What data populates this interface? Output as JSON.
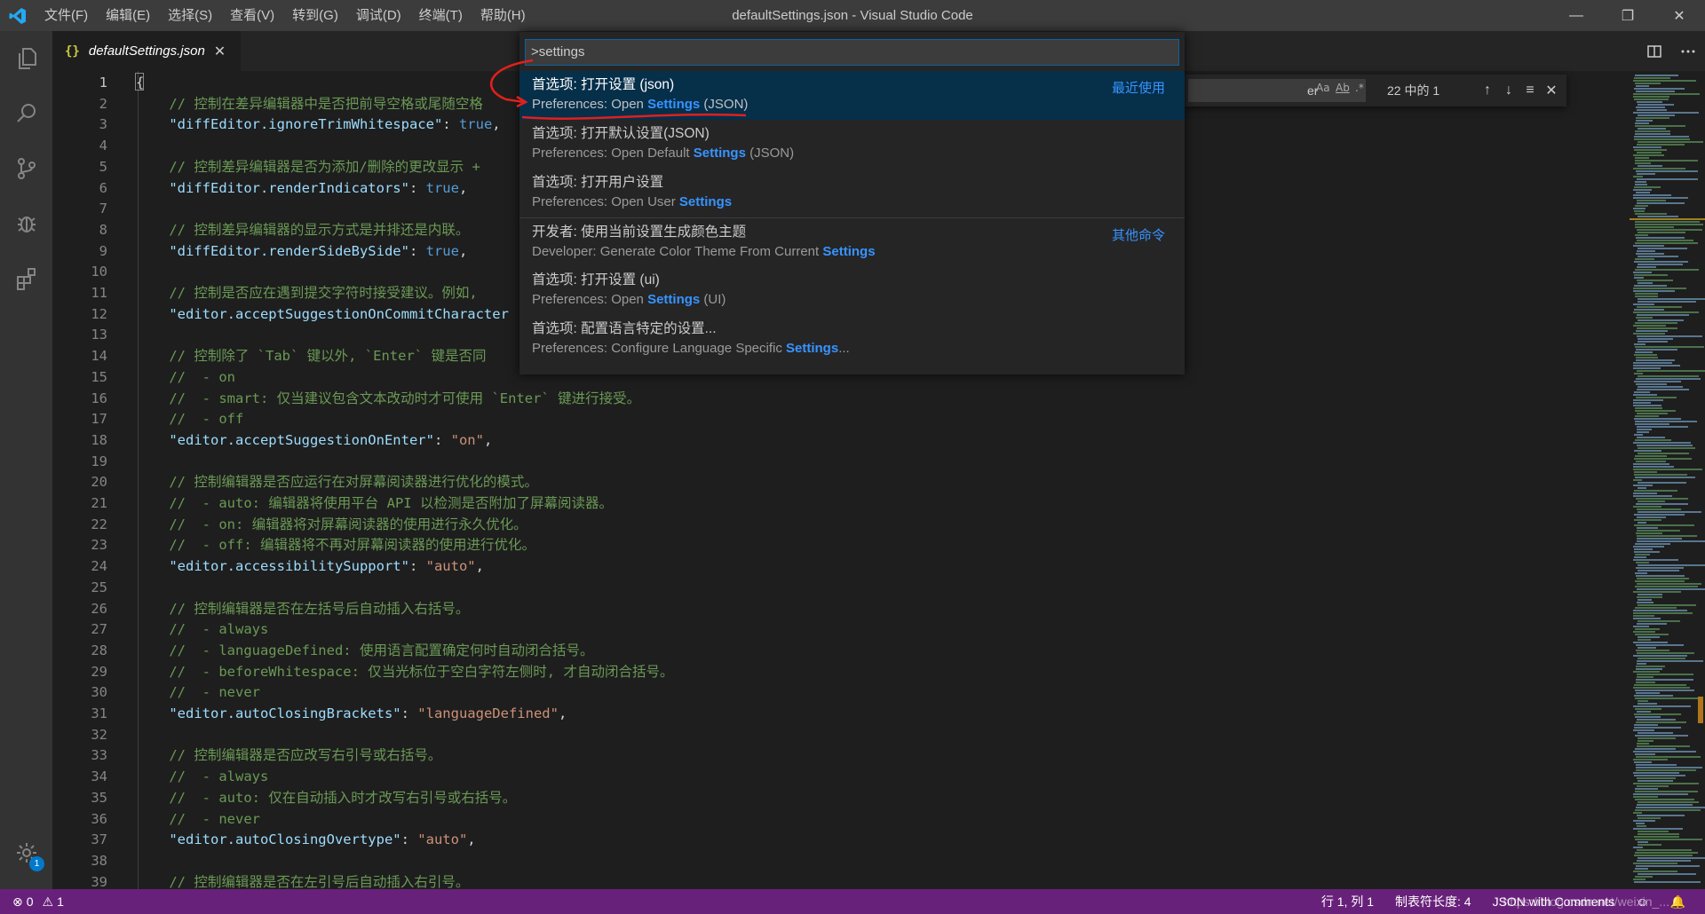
{
  "window": {
    "title": "defaultSettings.json - Visual Studio Code"
  },
  "menu": [
    "文件(F)",
    "编辑(E)",
    "选择(S)",
    "查看(V)",
    "转到(G)",
    "调试(D)",
    "终端(T)",
    "帮助(H)"
  ],
  "activity": [
    {
      "name": "explorer-icon"
    },
    {
      "name": "search-icon"
    },
    {
      "name": "source-control-icon"
    },
    {
      "name": "debug-icon"
    },
    {
      "name": "extensions-icon"
    }
  ],
  "settings_badge": "1",
  "tab": {
    "icon": "{}",
    "label": "defaultSettings.json",
    "close": "✕"
  },
  "find": {
    "value": "er",
    "opt_case": "Aa",
    "opt_word": "Ab",
    "opt_regex": ".*",
    "count": "22 中的 1"
  },
  "palette": {
    "input": ">settings",
    "items": [
      {
        "label": "首选项: 打开设置 (json)",
        "detail_pre": "Preferences: Open ",
        "detail_hl": "Settings",
        "detail_post": " (JSON)",
        "tag": "最近使用",
        "selected": true
      },
      {
        "label": "首选项: 打开默认设置(JSON)",
        "detail_pre": "Preferences: Open Default ",
        "detail_hl": "Settings",
        "detail_post": " (JSON)",
        "tag": ""
      },
      {
        "label": "首选项: 打开用户设置",
        "detail_pre": "Preferences: Open User ",
        "detail_hl": "Settings",
        "detail_post": "",
        "tag": ""
      },
      {
        "label": "开发者: 使用当前设置生成颜色主题",
        "detail_pre": "Developer: Generate Color Theme From Current ",
        "detail_hl": "Settings",
        "detail_post": "",
        "tag": "其他命令",
        "bordered": true
      },
      {
        "label": "首选项: 打开设置 (ui)",
        "detail_pre": "Preferences: Open ",
        "detail_hl": "Settings",
        "detail_post": " (UI)",
        "tag": ""
      },
      {
        "label": "首选项: 配置语言特定的设置...",
        "detail_pre": "Preferences: Configure Language Specific ",
        "detail_hl": "Settings",
        "detail_post": "...",
        "tag": ""
      }
    ]
  },
  "code_lines": [
    {
      "n": "1",
      "parts": [
        [
          "c-punc",
          "{"
        ]
      ]
    },
    {
      "n": "2",
      "parts": [
        [
          "c-comment",
          "    // 控制在差异编辑器中是否把前导空格或尾随空格"
        ]
      ]
    },
    {
      "n": "3",
      "parts": [
        [
          "c-key",
          "    \"diffEditor.ignoreTrimWhitespace\""
        ],
        [
          "c-punc",
          ": "
        ],
        [
          "c-bool",
          "true"
        ],
        [
          "c-punc",
          ","
        ]
      ]
    },
    {
      "n": "4",
      "parts": []
    },
    {
      "n": "5",
      "parts": [
        [
          "c-comment",
          "    // 控制差异编辑器是否为添加/删除的更改显示 +"
        ]
      ]
    },
    {
      "n": "6",
      "parts": [
        [
          "c-key",
          "    \"diffEditor.renderIndicators\""
        ],
        [
          "c-punc",
          ": "
        ],
        [
          "c-bool",
          "true"
        ],
        [
          "c-punc",
          ","
        ]
      ]
    },
    {
      "n": "7",
      "parts": []
    },
    {
      "n": "8",
      "parts": [
        [
          "c-comment",
          "    // 控制差异编辑器的显示方式是并排还是内联。"
        ]
      ]
    },
    {
      "n": "9",
      "parts": [
        [
          "c-key",
          "    \"diffEditor.renderSideBySide\""
        ],
        [
          "c-punc",
          ": "
        ],
        [
          "c-bool",
          "true"
        ],
        [
          "c-punc",
          ","
        ]
      ]
    },
    {
      "n": "10",
      "parts": []
    },
    {
      "n": "11",
      "parts": [
        [
          "c-comment",
          "    // 控制是否应在遇到提交字符时接受建议。例如,"
        ]
      ]
    },
    {
      "n": "12",
      "parts": [
        [
          "c-key",
          "    \"editor.acceptSuggestionOnCommitCharacter"
        ]
      ]
    },
    {
      "n": "13",
      "parts": []
    },
    {
      "n": "14",
      "parts": [
        [
          "c-comment",
          "    // 控制除了 `Tab` 键以外, `Enter` 键是否同"
        ]
      ]
    },
    {
      "n": "15",
      "parts": [
        [
          "c-comment",
          "    //  - on"
        ]
      ]
    },
    {
      "n": "16",
      "parts": [
        [
          "c-comment",
          "    //  - smart: 仅当建议包含文本改动时才可使用 `Enter` 键进行接受。"
        ]
      ]
    },
    {
      "n": "17",
      "parts": [
        [
          "c-comment",
          "    //  - off"
        ]
      ]
    },
    {
      "n": "18",
      "parts": [
        [
          "c-key",
          "    \"editor.acceptSuggestionOnEnter\""
        ],
        [
          "c-punc",
          ": "
        ],
        [
          "c-str",
          "\"on\""
        ],
        [
          "c-punc",
          ","
        ]
      ]
    },
    {
      "n": "19",
      "parts": []
    },
    {
      "n": "20",
      "parts": [
        [
          "c-comment",
          "    // 控制编辑器是否应运行在对屏幕阅读器进行优化的模式。"
        ]
      ]
    },
    {
      "n": "21",
      "parts": [
        [
          "c-comment",
          "    //  - auto: 编辑器将使用平台 API 以检测是否附加了屏幕阅读器。"
        ]
      ]
    },
    {
      "n": "22",
      "parts": [
        [
          "c-comment",
          "    //  - on: 编辑器将对屏幕阅读器的使用进行永久优化。"
        ]
      ]
    },
    {
      "n": "23",
      "parts": [
        [
          "c-comment",
          "    //  - off: 编辑器将不再对屏幕阅读器的使用进行优化。"
        ]
      ]
    },
    {
      "n": "24",
      "parts": [
        [
          "c-key",
          "    \"editor.accessibilitySupport\""
        ],
        [
          "c-punc",
          ": "
        ],
        [
          "c-str",
          "\"auto\""
        ],
        [
          "c-punc",
          ","
        ]
      ]
    },
    {
      "n": "25",
      "parts": []
    },
    {
      "n": "26",
      "parts": [
        [
          "c-comment",
          "    // 控制编辑器是否在左括号后自动插入右括号。"
        ]
      ]
    },
    {
      "n": "27",
      "parts": [
        [
          "c-comment",
          "    //  - always"
        ]
      ]
    },
    {
      "n": "28",
      "parts": [
        [
          "c-comment",
          "    //  - languageDefined: 使用语言配置确定何时自动闭合括号。"
        ]
      ]
    },
    {
      "n": "29",
      "parts": [
        [
          "c-comment",
          "    //  - beforeWhitespace: 仅当光标位于空白字符左侧时, 才自动闭合括号。"
        ]
      ]
    },
    {
      "n": "30",
      "parts": [
        [
          "c-comment",
          "    //  - never"
        ]
      ]
    },
    {
      "n": "31",
      "parts": [
        [
          "c-key",
          "    \"editor.autoClosingBrackets\""
        ],
        [
          "c-punc",
          ": "
        ],
        [
          "c-str",
          "\"languageDefined\""
        ],
        [
          "c-punc",
          ","
        ]
      ]
    },
    {
      "n": "32",
      "parts": []
    },
    {
      "n": "33",
      "parts": [
        [
          "c-comment",
          "    // 控制编辑器是否应改写右引号或右括号。"
        ]
      ]
    },
    {
      "n": "34",
      "parts": [
        [
          "c-comment",
          "    //  - always"
        ]
      ]
    },
    {
      "n": "35",
      "parts": [
        [
          "c-comment",
          "    //  - auto: 仅在自动插入时才改写右引号或右括号。"
        ]
      ]
    },
    {
      "n": "36",
      "parts": [
        [
          "c-comment",
          "    //  - never"
        ]
      ]
    },
    {
      "n": "37",
      "parts": [
        [
          "c-key",
          "    \"editor.autoClosingOvertype\""
        ],
        [
          "c-punc",
          ": "
        ],
        [
          "c-str",
          "\"auto\""
        ],
        [
          "c-punc",
          ","
        ]
      ]
    },
    {
      "n": "38",
      "parts": []
    },
    {
      "n": "39",
      "parts": [
        [
          "c-comment",
          "    // 控制编辑器是否在左引号后自动插入右引号。"
        ]
      ]
    }
  ],
  "status": {
    "errors": "0",
    "warnings": "1",
    "position": "行 1, 列 1",
    "tab_size": "制表符长度: 4",
    "language": "JSON with Comments",
    "watermark": "https://blog.csdn.net/weixin_..."
  },
  "colors": {
    "statusbar": "#68217a",
    "accent": "#3794ff",
    "selected": "#062f4a"
  }
}
